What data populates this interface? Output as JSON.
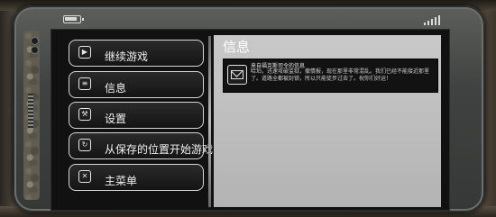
{
  "status_bar": {
    "battery_icon": "battery-icon",
    "signal_icon": "signal-icon"
  },
  "menu": {
    "items": [
      {
        "label": "继续游戏",
        "icon": "play-icon",
        "glyph": "▶"
      },
      {
        "label": "信息",
        "icon": "document-icon",
        "glyph": "≡"
      },
      {
        "label": "设置",
        "icon": "wrench-icon",
        "glyph": "⚒"
      },
      {
        "label": "从保存的位置开始游戏",
        "icon": "reload-icon",
        "glyph": "↻"
      },
      {
        "label": "主菜单",
        "icon": "close-icon",
        "glyph": "✕"
      }
    ]
  },
  "info_panel": {
    "title": "信息",
    "message": {
      "from": "来自福克斯司令的信息",
      "body": "哈珀，迅速攻破监狱，撤情报，现在那里非常混乱。我们已经不能接近那里了。道路全都被封锁，所以只能徒步过去了。祝你们好运！"
    }
  },
  "colors": {
    "panel_bg": "#c0c0c0",
    "screen_bg": "#111111",
    "button_border": "#d7d7d7"
  }
}
